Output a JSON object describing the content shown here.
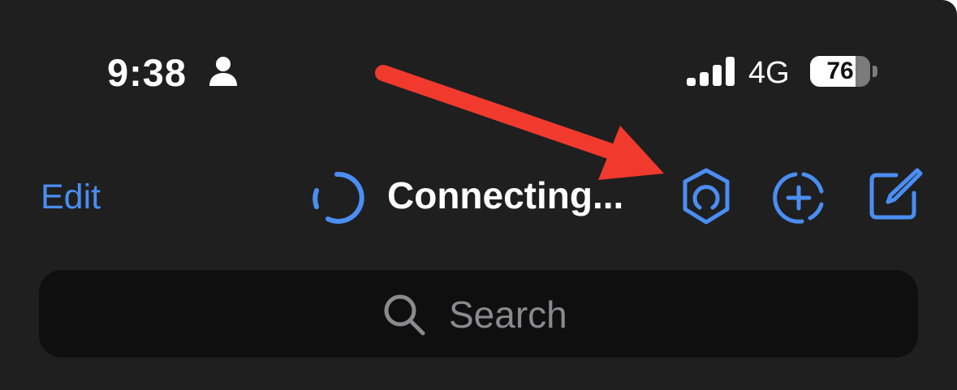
{
  "status_bar": {
    "time": "9:38",
    "network": "4G",
    "battery_level": "76",
    "battery_fraction": 0.76
  },
  "nav_bar": {
    "edit_label": "Edit",
    "title": "Connecting...",
    "icons": [
      "spinner-icon",
      "shield-icon",
      "add-story-icon",
      "compose-icon"
    ]
  },
  "search": {
    "placeholder": "Search"
  },
  "colors": {
    "background": "#1f1f1f",
    "accent": "#4a8ef2",
    "search_background": "#0f0f0f",
    "placeholder": "#8a8a8e",
    "annotation_arrow": "#f03a2e"
  }
}
